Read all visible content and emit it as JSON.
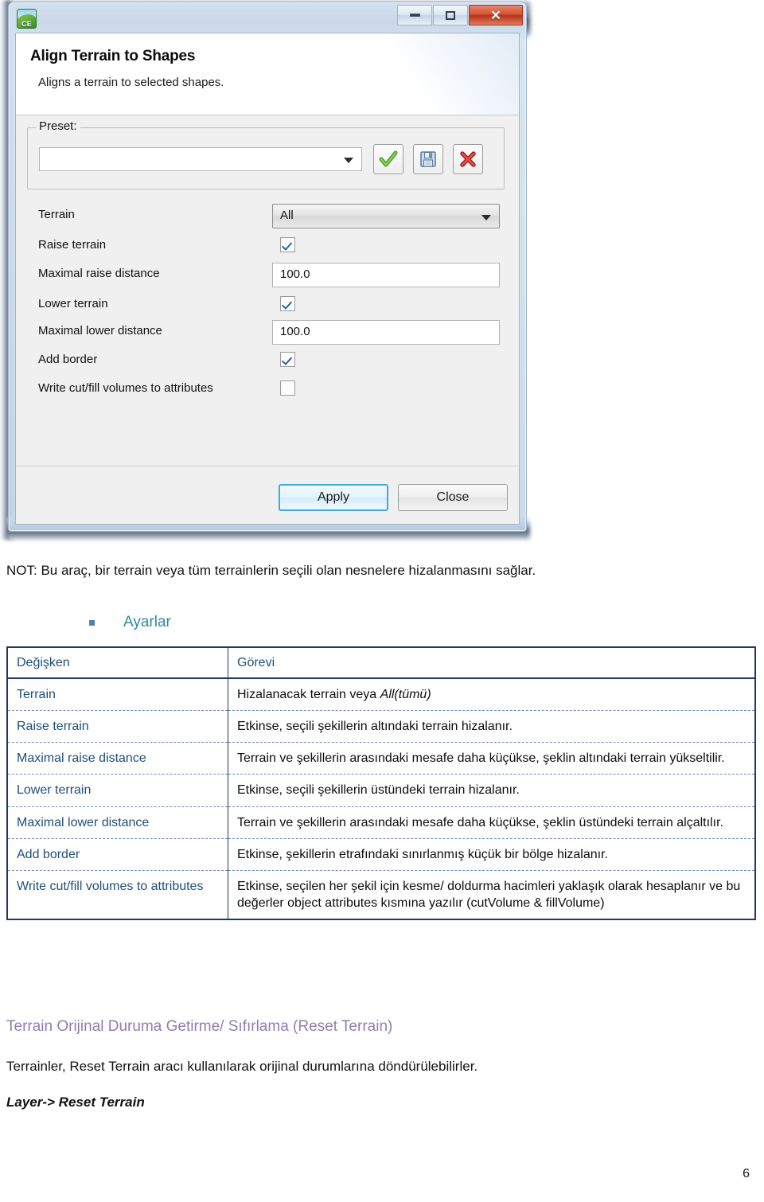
{
  "dialog": {
    "app_icon_label": "CE",
    "window_buttons": {
      "minimize": "minimize-icon",
      "maximize": "maximize-icon",
      "close": "✕"
    },
    "title": "Align Terrain to Shapes",
    "subtitle": "Aligns a terrain to selected shapes.",
    "preset": {
      "legend": "Preset:",
      "value": "",
      "placeholder": "",
      "apply_preset_icon": "check-icon",
      "save_preset_icon": "floppy-save-icon",
      "delete_preset_icon": "red-x-icon"
    },
    "fields": [
      {
        "label": "Terrain",
        "type": "combo",
        "value": "All"
      },
      {
        "label": "Raise terrain",
        "type": "checkbox",
        "checked": true
      },
      {
        "label": "Maximal raise distance",
        "type": "text",
        "value": "100.0"
      },
      {
        "label": "Lower terrain",
        "type": "checkbox",
        "checked": true
      },
      {
        "label": "Maximal lower distance",
        "type": "text",
        "value": "100.0"
      },
      {
        "label": "Add border",
        "type": "checkbox",
        "checked": true
      },
      {
        "label": "Write cut/fill volumes to attributes",
        "type": "checkbox",
        "checked": false
      }
    ],
    "buttons": {
      "apply": "Apply",
      "close": "Close"
    }
  },
  "document": {
    "note": "NOT: Bu araç, bir terrain veya tüm terrainlerin seçili olan nesnelere hizalanmasını sağlar.",
    "section_bullet_label": "Ayarlar",
    "table": {
      "headers": [
        "Değişken",
        "Görevi"
      ],
      "rows": [
        {
          "variable": "Terrain",
          "description_pre": "Hizalanacak terrain veya ",
          "description_em": "All(tümü)",
          "description_post": ""
        },
        {
          "variable": "Raise terrain",
          "description_pre": "Etkinse, seçili şekillerin altındaki terrain hizalanır.",
          "description_em": "",
          "description_post": ""
        },
        {
          "variable": "Maximal raise distance",
          "description_pre": "Terrain ve şekillerin arasındaki mesafe daha küçükse, şeklin altındaki terrain yükseltilir.",
          "description_em": "",
          "description_post": ""
        },
        {
          "variable": "Lower terrain",
          "description_pre": "Etkinse, seçili şekillerin üstündeki terrain hizalanır.",
          "description_em": "",
          "description_post": ""
        },
        {
          "variable": "Maximal lower distance",
          "description_pre": "Terrain ve şekillerin arasındaki mesafe daha küçükse, şeklin üstündeki terrain alçaltılır.",
          "description_em": "",
          "description_post": ""
        },
        {
          "variable": "Add border",
          "description_pre": "Etkinse, şekillerin etrafındaki sınırlanmış küçük bir bölge hizalanır.",
          "description_em": "",
          "description_post": ""
        },
        {
          "variable": "Write cut/fill volumes to attributes",
          "description_pre": "Etkinse, seçilen her şekil için kesme/ doldurma hacimleri yaklaşık olarak hesaplanır ve bu değerler object attributes kısmına yazılır (cutVolume & fillVolume)",
          "description_em": "",
          "description_post": ""
        }
      ]
    },
    "section_heading": "Terrain Orijinal Duruma Getirme/ Sıfırlama (Reset Terrain)",
    "section_paragraph": "Terrainler, Reset Terrain aracı kullanılarak orijinal durumlarına döndürülebilirler.",
    "section_path": "Layer-> Reset Terrain",
    "page_number": "6"
  },
  "colors": {
    "table_border": "#1f3864",
    "table_text_blue": "#1f4e79",
    "bullet_label": "#2f8a9e",
    "section_heading": "#8f7fb0",
    "close_button_red": "#c0392b",
    "primary_button_blue": "#3fa9e0"
  }
}
